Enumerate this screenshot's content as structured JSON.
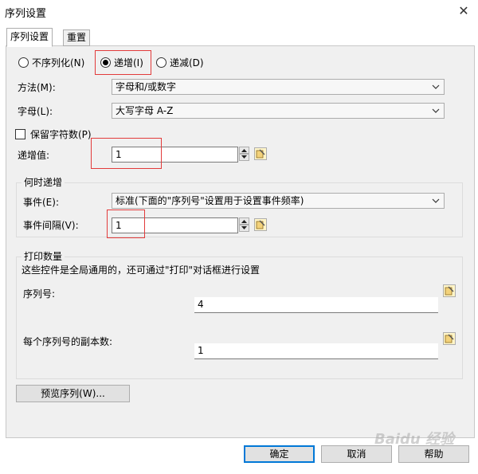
{
  "window": {
    "title": "序列设置",
    "close": "✕"
  },
  "tabs": [
    {
      "label": "序列设置",
      "active": true
    },
    {
      "label": "重置",
      "active": false
    }
  ],
  "mode": {
    "options": [
      "不序列化(N)",
      "递增(I)",
      "递减(D)"
    ],
    "selected": "递增(I)"
  },
  "method": {
    "label": "方法(M):",
    "value": "字母和/或数字"
  },
  "letters": {
    "label": "字母(L):",
    "value": "大写字母 A-Z"
  },
  "keep_chars": {
    "label": "保留字符数(P)",
    "checked": false
  },
  "increment": {
    "label": "递增值:",
    "value": "1"
  },
  "when_group": {
    "title": "何时递增",
    "event_label": "事件(E):",
    "event_value": "标准(下面的\"序列号\"设置用于设置事件频率)",
    "interval_label": "事件间隔(V):",
    "interval_value": "1"
  },
  "print_group": {
    "title": "打印数量",
    "note": "这些控件是全局通用的，还可通过\"打印\"对话框进行设置",
    "serial_label": "序列号:",
    "serial_value": "4",
    "copies_label": "每个序列号的副本数:",
    "copies_value": "1"
  },
  "preview_button": "预览序列(W)...",
  "footer": {
    "ok": "确定",
    "cancel": "取消",
    "help": "帮助"
  },
  "watermark": "Baidu 经验"
}
